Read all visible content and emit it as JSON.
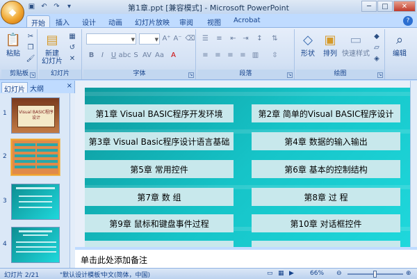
{
  "window": {
    "title": "第1章.ppt [兼容模式] - Microsoft PowerPoint",
    "minimize": "─",
    "maximize": "□",
    "close": "✕"
  },
  "ribbon_tabs": [
    "开始",
    "插入",
    "设计",
    "动画",
    "幻灯片放映",
    "审阅",
    "视图",
    "Acrobat"
  ],
  "ribbon": {
    "clipboard": {
      "paste": "粘贴",
      "label": "剪贴板"
    },
    "slides": {
      "new_slide": "新建\n幻灯片",
      "label": "幻灯片"
    },
    "font": {
      "label": "字体"
    },
    "paragraph": {
      "label": "段落"
    },
    "drawing": {
      "shapes": "形状",
      "arrange": "排列",
      "quick_styles": "快速样式",
      "label": "绘图"
    },
    "editing": {
      "label": "编辑"
    }
  },
  "left_pane": {
    "tab_slides": "幻灯片",
    "tab_outline": "大纲",
    "close": "×",
    "thumbnails": [
      {
        "num": "1",
        "title": "Visual BASIC程序设计"
      },
      {
        "num": "2",
        "title": ""
      },
      {
        "num": "3",
        "title": ""
      },
      {
        "num": "4",
        "title": ""
      }
    ]
  },
  "slide": {
    "chapters": [
      "第1章 Visual BASIC程序开发环境",
      "第2章   简单的Visual BASIC程序设计",
      "第3章   Visual Basic程序设计语言基础",
      "第4章   数据的输入输出",
      "第5章   常用控件",
      "第6章   基本的控制结构",
      "第7章   数   组",
      "第8章   过   程",
      "第9章   鼠标和键盘事件过程",
      "第10章   对话框控件"
    ]
  },
  "notes": {
    "placeholder": "单击此处添加备注"
  },
  "status": {
    "slide_counter": "幻灯片 2/21",
    "theme": "\"默认设计模板\"",
    "language": "中文(简体，中国)",
    "zoom": "66%",
    "zoom_level": 0.5
  },
  "colors": {
    "slide_bg": "#16c4c8",
    "chapter_box": "#c8e8ec",
    "ribbon": "#dbe7f6"
  }
}
